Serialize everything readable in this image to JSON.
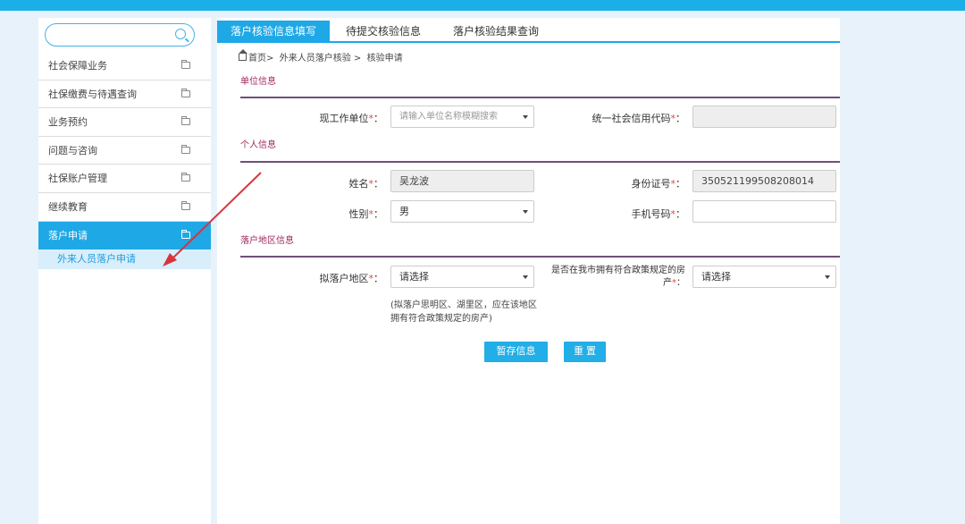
{
  "sidebar": {
    "search_placeholder": "",
    "items": [
      {
        "label": "社会保障业务"
      },
      {
        "label": "社保缴费与待遇查询"
      },
      {
        "label": "业务预约"
      },
      {
        "label": "问题与咨询"
      },
      {
        "label": "社保账户管理"
      },
      {
        "label": "继续教育"
      },
      {
        "label": "落户申请"
      }
    ],
    "sub_items": [
      {
        "label": "外来人员落户申请"
      }
    ]
  },
  "tabs": [
    {
      "label": "落户核验信息填写",
      "active": true
    },
    {
      "label": "待提交核验信息",
      "active": false
    },
    {
      "label": "落户核验结果查询",
      "active": false
    }
  ],
  "breadcrumb": {
    "home": "首页>",
    "level1": "外来人员落户核验 >",
    "level2": "核验申请"
  },
  "sections": {
    "unit": "单位信息",
    "personal": "个人信息",
    "region": "落户地区信息"
  },
  "form": {
    "work_unit_label": "现工作单位",
    "work_unit_placeholder": "请输入单位名称模糊搜索",
    "credit_code_label": "统一社会信用代码",
    "credit_code_value": "",
    "name_label": "姓名",
    "name_value": "吴龙波",
    "id_label": "身份证号",
    "id_value": "350521199508208014",
    "gender_label": "性别",
    "gender_value": "男",
    "phone_label": "手机号码",
    "phone_value": "",
    "region_label": "拟落户地区",
    "region_value": "请选择",
    "house_label_line1": "是否在我市拥有符合政策规定的房",
    "house_label_line2": "产",
    "house_value": "请选择",
    "note": "(拟落户思明区、湖里区，应在该地区拥有符合政策规定的房产)",
    "required_mark": "*",
    "colon": "："
  },
  "buttons": {
    "save": "暂存信息",
    "reset": "重 置"
  },
  "colors": {
    "accent": "#1ea8e6",
    "section_title": "#a0295e",
    "annotation_arrow": "#d9343c"
  }
}
